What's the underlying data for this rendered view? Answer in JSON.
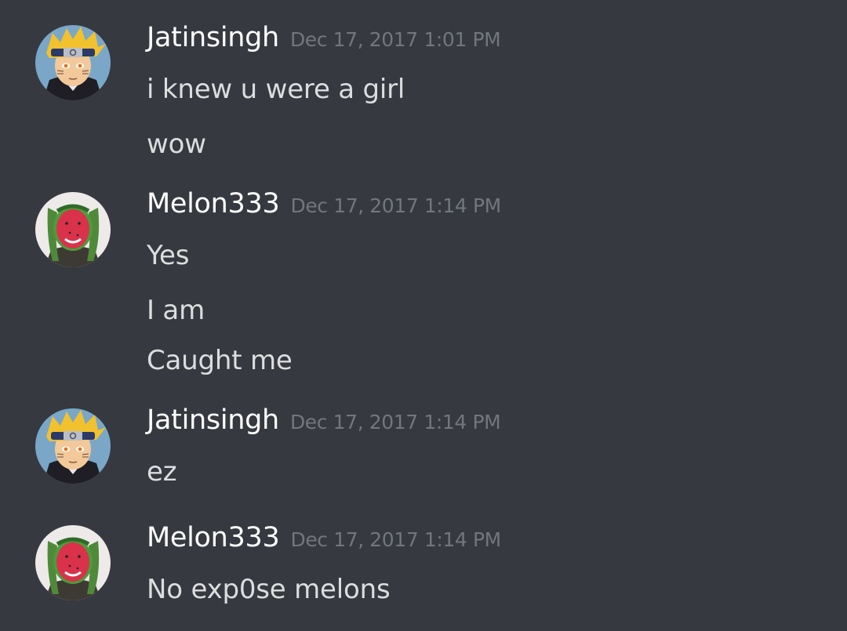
{
  "colors": {
    "background": "#36393f",
    "username": "#ffffff",
    "timestamp": "#72767d",
    "message_text": "#dcddde"
  },
  "groups": [
    {
      "avatar_icon": "naruto-avatar-icon",
      "username": "Jatinsingh",
      "timestamp": "Dec 17, 2017 1:01 PM",
      "messages": [
        "i knew u were a girl",
        "wow"
      ]
    },
    {
      "avatar_icon": "melon-face-avatar-icon",
      "username": "Melon333",
      "timestamp": "Dec 17, 2017 1:14 PM",
      "messages": [
        "Yes",
        "I am",
        "Caught me"
      ]
    },
    {
      "avatar_icon": "naruto-avatar-icon",
      "username": "Jatinsingh",
      "timestamp": "Dec 17, 2017 1:14 PM",
      "messages": [
        "ez"
      ]
    },
    {
      "avatar_icon": "melon-face-avatar-icon",
      "username": "Melon333",
      "timestamp": "Dec 17, 2017 1:14 PM",
      "messages": [
        "No exp0se melons"
      ]
    }
  ]
}
